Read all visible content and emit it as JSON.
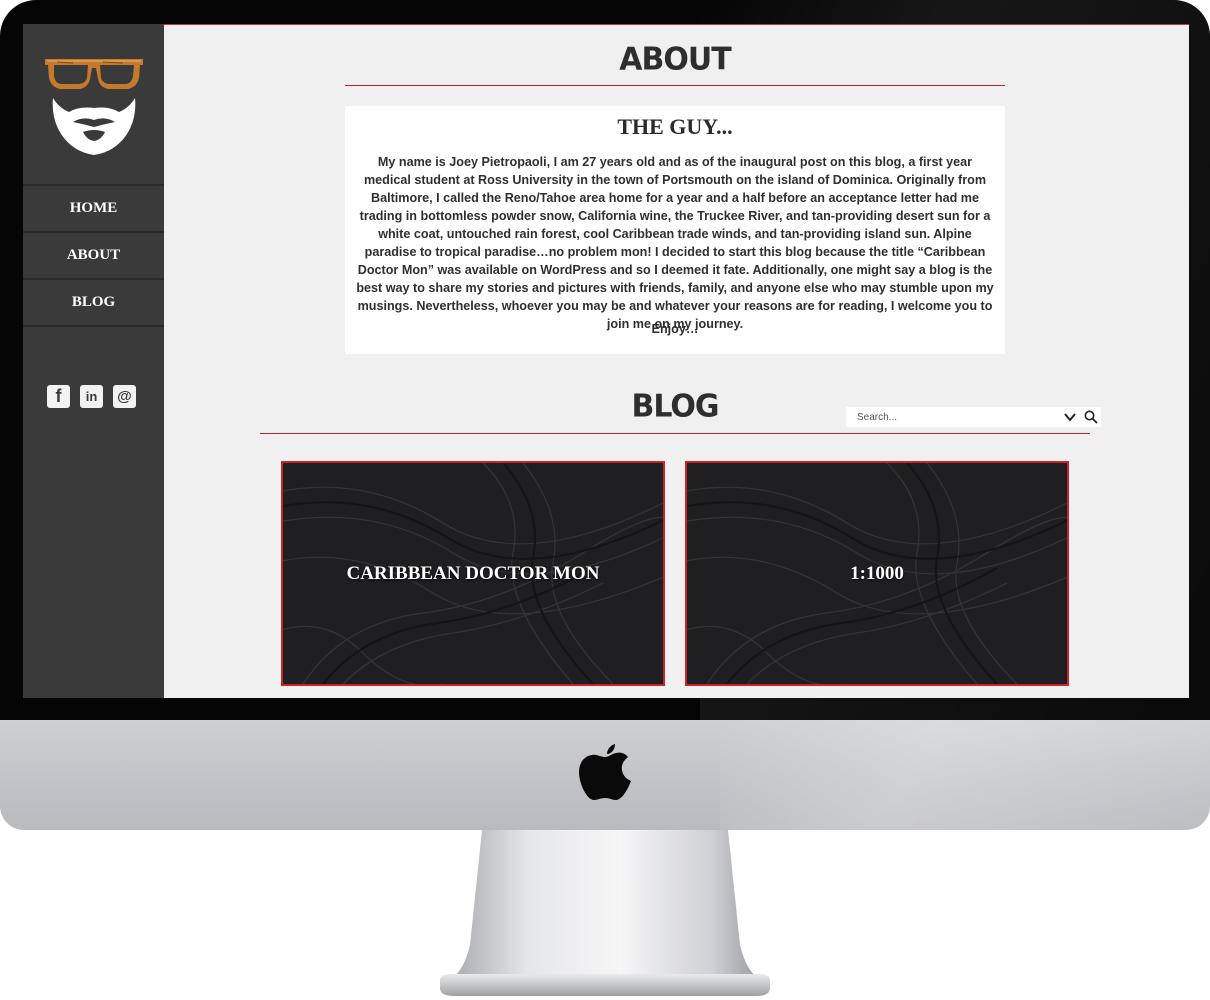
{
  "sidebar": {
    "nav": [
      {
        "label": "HOME"
      },
      {
        "label": "ABOUT"
      },
      {
        "label": "BLOG"
      }
    ],
    "social": [
      {
        "icon": "facebook-icon",
        "glyph": "f"
      },
      {
        "icon": "linkedin-icon",
        "glyph": "in"
      },
      {
        "icon": "email-icon",
        "glyph": "@"
      }
    ]
  },
  "about": {
    "title": "ABOUT",
    "heading": "THE GUY...",
    "body": "My name is Joey Pietropaoli, I am 27 years old and as of the inaugural post on this blog, a first year medical student at Ross University in the town of Portsmouth on the island of Dominica. Originally from Baltimore, I called the Reno/Tahoe area home for a year and a half before an acceptance letter had me trading in bottomless powder snow, California wine, the Truckee River, and tan-providing desert sun for a white coat, untouched rain forest, cool Caribbean trade winds, and tan-providing island sun. Alpine paradise to tropical paradise…no problem mon! I decided to start this blog because the title “Caribbean Doctor Mon” was available on WordPress and so I deemed it fate. Additionally, one might say a blog is the best way to share my stories and pictures with friends, family, and anyone else who may stumble upon my musings. Nevertheless, whoever you may be and whatever your reasons are for reading, I welcome you to join me on my journey.",
    "closing": "Enjoy…"
  },
  "blog": {
    "title": "BLOG",
    "search_placeholder": "Search...",
    "posts": [
      {
        "title": "CARIBBEAN DOCTOR MON"
      },
      {
        "title": "1:1000"
      }
    ]
  },
  "colors": {
    "accent": "#c8242a",
    "sidebar": "#3a3a3a",
    "page_bg": "#f0f0f0"
  }
}
